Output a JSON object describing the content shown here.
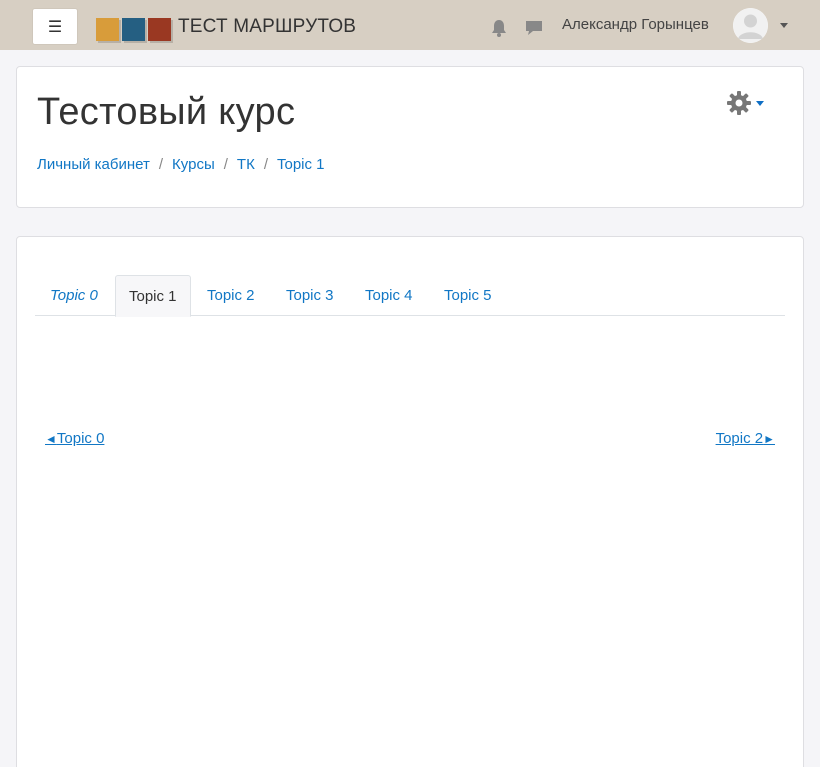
{
  "navbar": {
    "menu_icon": "hamburger-icon",
    "menu_glyph": "☰",
    "site_title": "ТЕСТ МАРШРУТОВ",
    "logo_colors": [
      "#d89c3a",
      "#255f82",
      "#9a3822"
    ],
    "notifications_icon": "bell-icon",
    "messages_icon": "chat-icon",
    "user_name": "Александр Горынцев"
  },
  "header": {
    "course_title": "Тестовый курс",
    "settings_icon": "gear-icon",
    "breadcrumb": [
      "Личный кабинет",
      "Курсы",
      "ТК",
      "Topic 1"
    ],
    "separator": "/"
  },
  "tabs": [
    {
      "label": "Topic 0",
      "active": false
    },
    {
      "label": "Topic 1",
      "active": true
    },
    {
      "label": "Topic 2",
      "active": false
    },
    {
      "label": "Topic 3",
      "active": false
    },
    {
      "label": "Topic 4",
      "active": false
    },
    {
      "label": "Topic 5",
      "active": false
    }
  ],
  "section_nav": {
    "prev_label": "Topic 0",
    "prev_arrow": "◄",
    "next_label": "Topic 2",
    "next_arrow": "►"
  },
  "colors": {
    "navbar_bg": "#d7cfc3",
    "link": "#1177c5",
    "page_bg": "#f5f5f8"
  }
}
